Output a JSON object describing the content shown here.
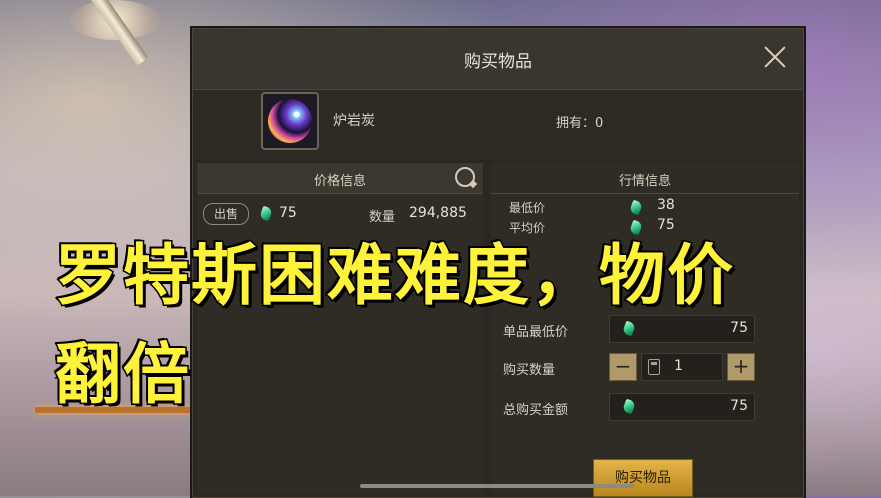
{
  "dialog": {
    "title": "购买物品",
    "item_name": "炉岩炭",
    "owned_text": "拥有：0"
  },
  "price_info": {
    "header": "价格信息",
    "sell_badge": "出售",
    "sell_price": "75",
    "qty_label": "数量",
    "qty_value": "294,885"
  },
  "market_info": {
    "header": "行情信息",
    "rows": [
      {
        "label": "最低价",
        "value": "38"
      },
      {
        "label": "平均价",
        "value": "75"
      },
      {
        "label": "",
        "value": ""
      }
    ]
  },
  "purchase": {
    "unit_min_label": "单品最低价",
    "unit_min_value": "75",
    "qty_label": "购买数量",
    "qty_value": "1",
    "minus": "−",
    "plus": "+",
    "total_label": "总购买金额",
    "total_value": "75",
    "buy_button": "购买物品"
  },
  "overlay": {
    "line1": "罗特斯困难难度，物价",
    "line2": "翻倍"
  },
  "colors": {
    "overlay_text": "#fff23a",
    "buy_button": "#e3b448",
    "gem": "#2fbf7e"
  }
}
